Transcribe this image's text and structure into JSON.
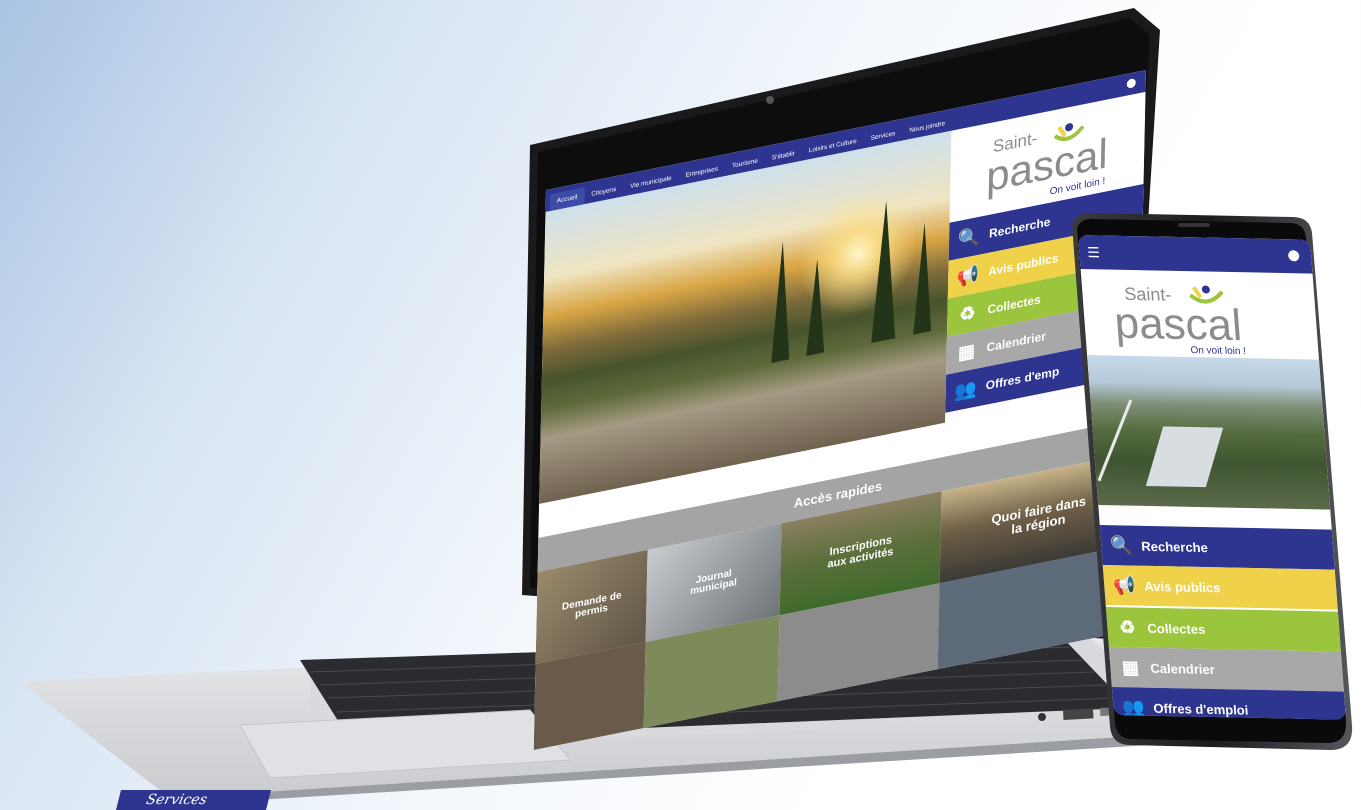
{
  "nav": {
    "items": [
      "Accueil",
      "Citoyens",
      "Vie municipale",
      "Entreprises",
      "Tourisme",
      "S'établir",
      "Loisirs et Culture",
      "Services",
      "Nous joindre"
    ],
    "active": "Accueil"
  },
  "logo": {
    "saint": "Saint-",
    "pascal": "pascal",
    "slogan": "On voit loin !"
  },
  "quick_links": [
    {
      "label": "Recherche",
      "color": "#2d3590",
      "icon": "search-icon",
      "glyph": "🔍"
    },
    {
      "label": "Avis publics",
      "color": "#f0d24a",
      "icon": "megaphone-icon",
      "glyph": "📢"
    },
    {
      "label": "Collectes",
      "color": "#9bc53d",
      "icon": "recycle-icon",
      "glyph": "♻"
    },
    {
      "label": "Calendrier",
      "color": "#a8a8a8",
      "icon": "calendar-icon",
      "glyph": "▦"
    },
    {
      "label": "Offres d'emploi",
      "color": "#2d3590",
      "icon": "people-icon",
      "glyph": "👥"
    }
  ],
  "laptop_quick_labels": [
    "Recherche",
    "Avis publics",
    "Collectes",
    "Calendrier",
    "Offres d'emp"
  ],
  "acces": "Accès rapides",
  "tiles": [
    {
      "label": "Demande de permis"
    },
    {
      "label": "Journal municipal"
    },
    {
      "label": "Inscriptions aux activités"
    },
    {
      "label": "Quoi faire dans la région"
    }
  ],
  "badge": "Services"
}
